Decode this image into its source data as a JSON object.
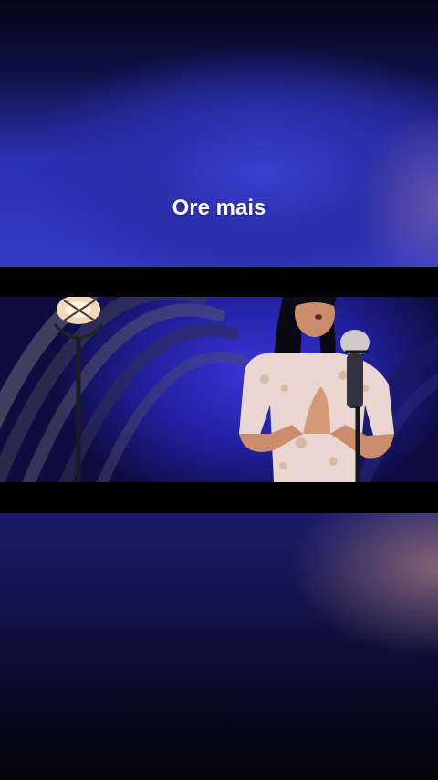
{
  "caption": "Ore mais",
  "colors": {
    "bars": "#000000",
    "stage_blue": "#2f33c2",
    "caption": "#ffffff"
  },
  "scene": {
    "lamp_icon": "lamp-icon",
    "microphone_icon": "microphone-icon"
  }
}
